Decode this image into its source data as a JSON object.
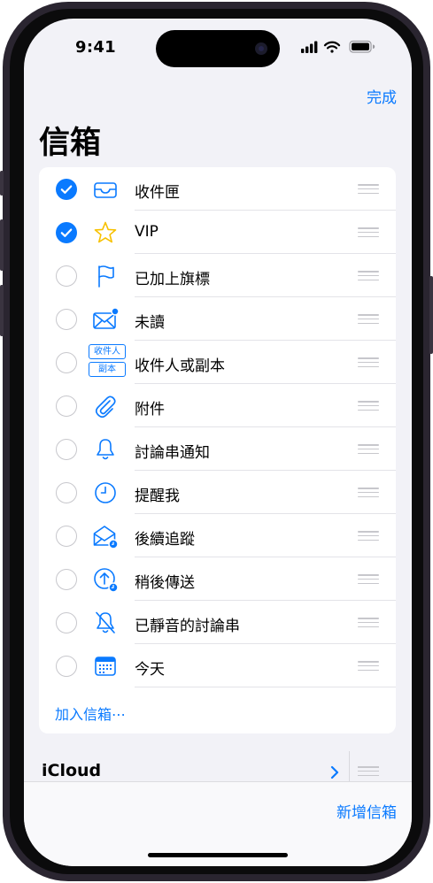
{
  "status_bar": {
    "time": "9:41"
  },
  "nav": {
    "done_label": "完成"
  },
  "page_title": "信箱",
  "accent_color": "#0a7aff",
  "mailboxes": [
    {
      "label": "收件匣",
      "checked": true,
      "icon": "inbox-tray-icon"
    },
    {
      "label": "VIP",
      "checked": true,
      "icon": "star-icon"
    },
    {
      "label": "已加上旗標",
      "checked": false,
      "icon": "flag-icon"
    },
    {
      "label": "未讀",
      "checked": false,
      "icon": "unread-envelope-icon"
    },
    {
      "label": "收件人或副本",
      "checked": false,
      "icon": "to-cc-icon"
    },
    {
      "label": "附件",
      "checked": false,
      "icon": "paperclip-icon"
    },
    {
      "label": "討論串通知",
      "checked": false,
      "icon": "bell-icon"
    },
    {
      "label": "提醒我",
      "checked": false,
      "icon": "clock-icon"
    },
    {
      "label": "後續追蹤",
      "checked": false,
      "icon": "follow-up-envelope-icon"
    },
    {
      "label": "稍後傳送",
      "checked": false,
      "icon": "send-later-icon"
    },
    {
      "label": "已靜音的討論串",
      "checked": false,
      "icon": "bell-slash-icon"
    },
    {
      "label": "今天",
      "checked": false,
      "icon": "calendar-icon"
    }
  ],
  "to_cc_icon": {
    "to_text": "收件人",
    "cc_text": "副本"
  },
  "add_mailbox_label": "加入信箱⋯",
  "account": {
    "name": "iCloud"
  },
  "bottom_bar": {
    "new_mailbox_label": "新增信箱"
  }
}
